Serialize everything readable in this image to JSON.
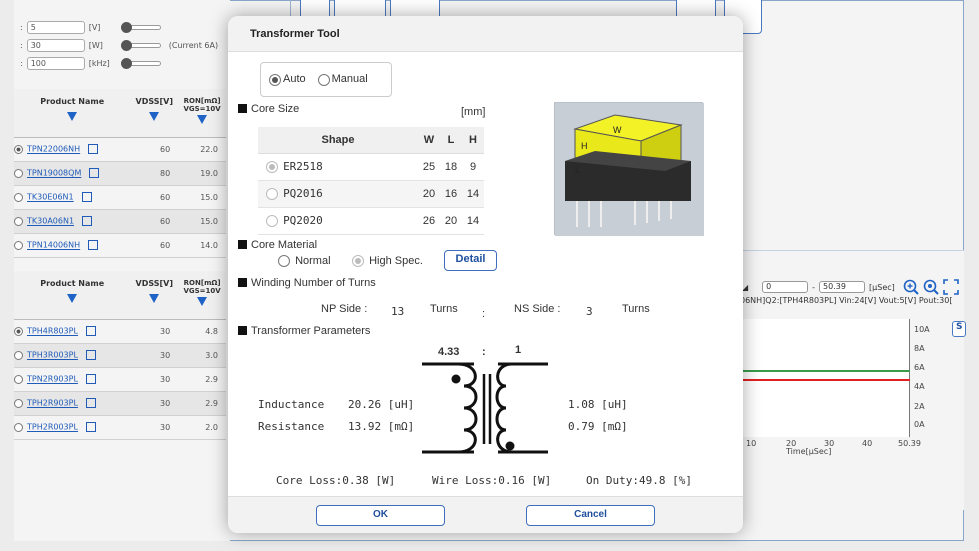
{
  "left_panel": {
    "params": [
      {
        "value": "5",
        "unit": "[V]"
      },
      {
        "value": "30",
        "unit": "[W]",
        "note": "(Current 6A)"
      },
      {
        "value": "100",
        "unit": "[kHz]"
      }
    ],
    "table1": {
      "headers": {
        "product": "Product Name",
        "vdss": "VDSS[V]",
        "ron": "RON[mΩ]",
        "vgs": "VGS=10V"
      },
      "rows": [
        {
          "name": "TPN22006NH",
          "v": "60",
          "r": "22.0",
          "selected": true
        },
        {
          "name": "TPN19008QM",
          "v": "80",
          "r": "19.0"
        },
        {
          "name": "TK30E06N1",
          "v": "60",
          "r": "15.0"
        },
        {
          "name": "TK30A06N1",
          "v": "60",
          "r": "15.0"
        },
        {
          "name": "TPN14006NH",
          "v": "60",
          "r": "14.0"
        }
      ]
    },
    "table2": {
      "headers": {
        "product": "Product Name",
        "vdss": "VDSS[V]",
        "ron": "RON[mΩ]",
        "vgs": "VGS=10V"
      },
      "rows": [
        {
          "name": "TPH4R803PL",
          "v": "30",
          "r": "4.8",
          "selected": true
        },
        {
          "name": "TPH3R003PL",
          "v": "30",
          "r": "3.0"
        },
        {
          "name": "TPN2R903PL",
          "v": "30",
          "r": "2.9"
        },
        {
          "name": "TPH2R903PL",
          "v": "30",
          "r": "2.9"
        },
        {
          "name": "TPH2R003PL",
          "v": "30",
          "r": "2.0"
        }
      ]
    }
  },
  "graph": {
    "range_start": "0",
    "range_end": "50.39",
    "unit": "[μSec]",
    "title": "06NH]Q2:[TPH4R803PL] Vin:24[V] Vout:5[V] Pout:30[",
    "y_ticks": [
      "10A",
      "8A",
      "6A",
      "4A",
      "2A",
      "0A"
    ],
    "x_ticks": [
      "10",
      "20",
      "30",
      "40",
      "50.39"
    ],
    "xlabel": "Time[μSec]",
    "side_button": "S",
    "line_colors": {
      "green": "#3a9a4a",
      "red": "#e02020"
    }
  },
  "dialog": {
    "title": "Transformer Tool",
    "mode": {
      "auto": "Auto",
      "manual": "Manual"
    },
    "core_size": {
      "heading": "Core Size",
      "unit": "[mm]",
      "columns": [
        "Shape",
        "W",
        "L",
        "H"
      ],
      "rows": [
        {
          "shape": "ER2518",
          "w": "25",
          "l": "18",
          "h": "9"
        },
        {
          "shape": "PQ2016",
          "w": "20",
          "l": "16",
          "h": "14"
        },
        {
          "shape": "PQ2020",
          "w": "26",
          "l": "20",
          "h": "14"
        }
      ],
      "image_labels": {
        "w": "W",
        "h": "H",
        "l": "L"
      }
    },
    "core_material": {
      "heading": "Core Material",
      "normal": "Normal",
      "high": "High Spec.",
      "detail": "Detail"
    },
    "winding": {
      "heading": "Winding Number of Turns",
      "np_label": "NP Side :",
      "np_value": "13",
      "turns1": "Turns",
      "colon": ":",
      "ns_label": "NS Side :",
      "ns_value": "3",
      "turns2": "Turns"
    },
    "params": {
      "heading": "Transformer Parameters",
      "ratio_left": "4.33",
      "ratio_colon": ":",
      "ratio_right": "1",
      "inductance_label": "Inductance",
      "inductance_p": "20.26  [uH]",
      "inductance_s": "1.08  [uH]",
      "resistance_label": "Resistance",
      "resistance_p": "13.92 [mΩ]",
      "resistance_s": "0.79 [mΩ]",
      "core_loss": "Core Loss:0.38  [W]",
      "wire_loss": "Wire Loss:0.16  [W]",
      "on_duty": "On Duty:49.8  [%]"
    },
    "ok": "OK",
    "cancel": "Cancel"
  }
}
